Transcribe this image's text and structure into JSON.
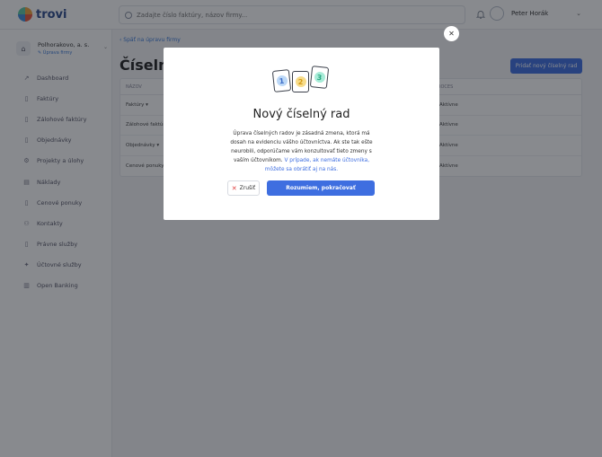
{
  "app": {
    "logo_text": "trovi"
  },
  "search": {
    "placeholder": "Zadajte číslo faktúry, názov firmy..."
  },
  "user": {
    "name": "Peter Horák"
  },
  "company": {
    "name": "Polhorakovo, a. s.",
    "edit_label": "✎ Úprava firmy"
  },
  "sidebar": {
    "items": [
      {
        "label": "Dashboard",
        "icon": "chart-line-icon"
      },
      {
        "label": "Faktúry",
        "icon": "document-icon"
      },
      {
        "label": "Zálohové faktúry",
        "icon": "document-icon"
      },
      {
        "label": "Objednávky",
        "icon": "document-icon"
      },
      {
        "label": "Projekty a úlohy",
        "icon": "gear-icon"
      },
      {
        "label": "Náklady",
        "icon": "receipt-icon"
      },
      {
        "label": "Cenové ponuky",
        "icon": "document-icon"
      },
      {
        "label": "Kontakty",
        "icon": "people-icon"
      },
      {
        "label": "Právne služby",
        "icon": "document-icon"
      },
      {
        "label": "Účtovné služby",
        "icon": "calculator-icon"
      },
      {
        "label": "Open Banking",
        "icon": "bank-icon"
      }
    ]
  },
  "main": {
    "back_link": "‹ Späť na úpravu firmy",
    "title": "Číselné",
    "add_button": "Pridať nový číselný rad",
    "table": {
      "headers": [
        "NÁZOV",
        "PROCES"
      ],
      "rows": [
        {
          "name": "Faktúry ▾",
          "status": "Aktívne"
        },
        {
          "name": "Zálohové faktúry",
          "status": "Aktívne"
        },
        {
          "name": "Objednávky ▾",
          "status": "Aktívne"
        },
        {
          "name": "Cenové ponuky ▾",
          "status": "Aktívne"
        }
      ]
    }
  },
  "modal": {
    "cards": [
      "1",
      "2",
      "3"
    ],
    "card_colors": [
      "#bcd8f7",
      "#f7dc8a",
      "#a8ecd8"
    ],
    "title": "Nový číselný rad",
    "text": "Úprava číselných radov je zásadná zmena, ktorá má dosah na evidenciu vášho účtovníctva. Ak ste tak ešte neurobili, odporúčame vám konzultovať tieto zmeny s vaším účtovníkom.",
    "link": "V prípade, ak nemáte účtovníka, môžete sa obrátiť aj na nás.",
    "cancel_label": "Zrušiť",
    "confirm_label": "Rozumiem, pokračovať"
  }
}
